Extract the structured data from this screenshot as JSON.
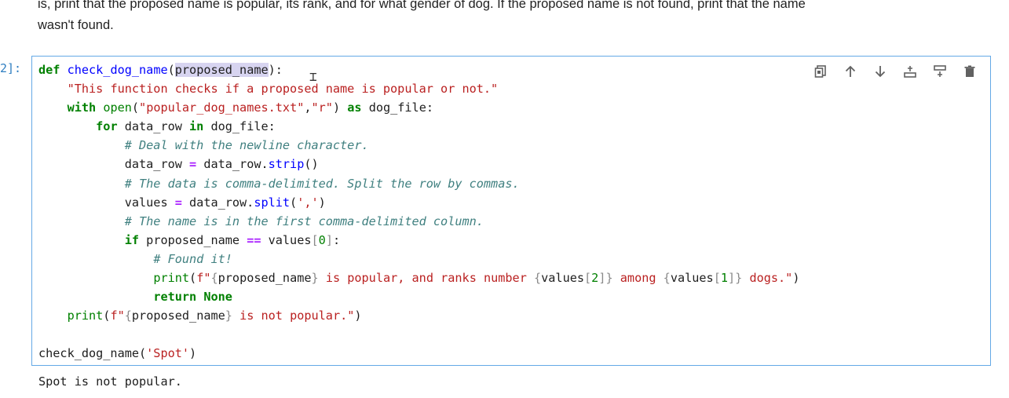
{
  "markdown": {
    "line1": "is, print that the proposed name is popular, its rank, and for what gender of dog. If the proposed name is not found, print that the name",
    "line2": "wasn't found."
  },
  "cell": {
    "prompt": "2]:",
    "code_lines": [
      "def check_dog_name(proposed_name):",
      "    \"This function checks if a proposed name is popular or not.\"",
      "    with open(\"popular_dog_names.txt\",\"r\") as dog_file:",
      "        for data_row in dog_file:",
      "            # Deal with the newline character.",
      "            data_row = data_row.strip()",
      "            # The data is comma-delimited. Split the row by commas.",
      "            values = data_row.split(',')",
      "            # The name is in the first comma-delimited column.",
      "            if proposed_name == values[0]:",
      "                # Found it!",
      "                print(f\"{proposed_name} is popular, and ranks number {values[2]} among {values[1]} dogs.\")",
      "                return None",
      "    print(f\"{proposed_name} is not popular.\")",
      "",
      "check_dog_name('Spot')"
    ],
    "toolbar": [
      {
        "name": "duplicate-cell-button",
        "icon": "copy-icon"
      },
      {
        "name": "move-up-button",
        "icon": "arrow-up-icon"
      },
      {
        "name": "move-down-button",
        "icon": "arrow-down-icon"
      },
      {
        "name": "insert-above-button",
        "icon": "insert-above-icon"
      },
      {
        "name": "insert-below-button",
        "icon": "insert-below-icon"
      },
      {
        "name": "delete-cell-button",
        "icon": "trash-icon"
      }
    ]
  },
  "output": {
    "text": "Spot is not popular."
  },
  "colors": {
    "cell_border": "#64a9e6",
    "prompt": "#307fc1",
    "keyword": "#008000",
    "string": "#ba2121",
    "comment": "#408080",
    "operator": "#aa22ff",
    "selection": "#d7d4f0"
  }
}
